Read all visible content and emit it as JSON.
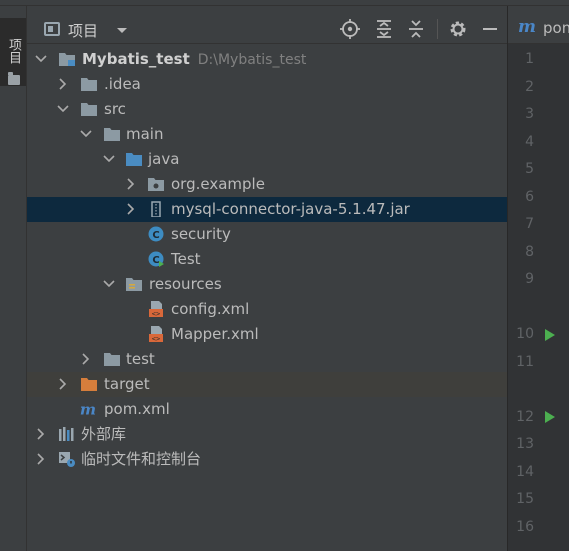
{
  "stripe": {
    "label": "项目"
  },
  "toolbar": {
    "title": "项目"
  },
  "tree": [
    {
      "label": "Mybatis_test",
      "path": "D:\\Mybatis_test",
      "icon": "module-folder-icon",
      "expanded": true
    },
    {
      "label": ".idea",
      "icon": "folder-icon"
    },
    {
      "label": "src",
      "icon": "folder-icon"
    },
    {
      "label": "main",
      "icon": "folder-icon"
    },
    {
      "label": "java",
      "icon": "source-folder-icon"
    },
    {
      "label": "org.example",
      "icon": "package-icon"
    },
    {
      "label": "mysql-connector-java-5.1.47.jar",
      "icon": "jar-icon"
    },
    {
      "label": "security",
      "icon": "java-class-icon"
    },
    {
      "label": "Test",
      "icon": "java-class-icon"
    },
    {
      "label": "resources",
      "icon": "resources-folder-icon"
    },
    {
      "label": "config.xml",
      "icon": "xml-file-icon"
    },
    {
      "label": "Mapper.xml",
      "icon": "xml-file-icon"
    },
    {
      "label": "test",
      "icon": "folder-icon"
    },
    {
      "label": "target",
      "icon": "excluded-folder-icon"
    },
    {
      "label": "pom.xml",
      "icon": "maven-icon"
    },
    {
      "label": "外部库",
      "icon": "libraries-icon"
    },
    {
      "label": "临时文件和控制台",
      "icon": "scratches-icon"
    }
  ],
  "editor": {
    "tab_label": "pom",
    "line_numbers": [
      "1",
      "2",
      "3",
      "4",
      "5",
      "6",
      "7",
      "8",
      "9",
      "10",
      "11",
      "12",
      "13",
      "14",
      "15",
      "16"
    ]
  },
  "colors": {
    "panel_bg": "#3c3f41",
    "selection": "#0d293e",
    "folder": "#8c9aa3",
    "source_folder": "#4a8cc2",
    "excluded_folder": "#d67e3c",
    "class_icon": "#3d8cc2",
    "run_gutter": "#4caf50"
  }
}
